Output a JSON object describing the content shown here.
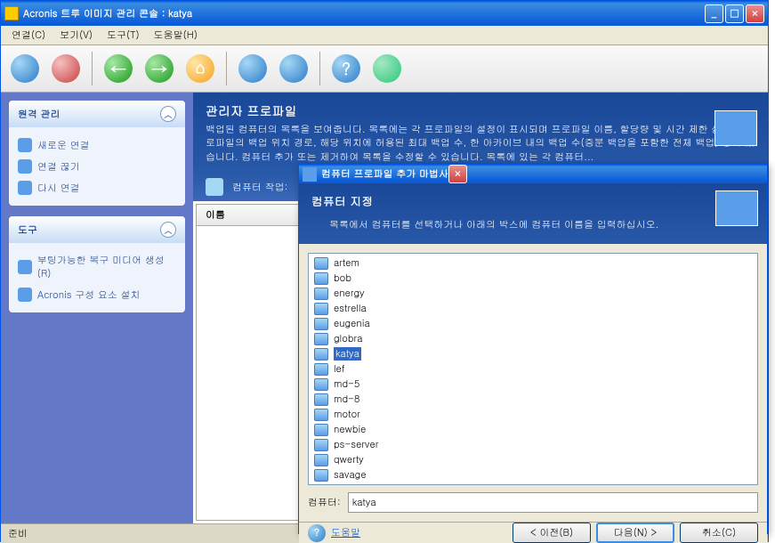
{
  "main": {
    "title": "Acronis 트루 이미지 관리 콘솔 : katya",
    "menu": {
      "connect": "연결(C)",
      "view": "보기(V)",
      "tools": "도구(T)",
      "help": "도움말(H)"
    },
    "sidebar": {
      "panel1": {
        "title": "원격 관리",
        "links": [
          "새로운 연결",
          "연결 끊기",
          "다시 연결"
        ]
      },
      "panel2": {
        "title": "도구",
        "links": [
          "부팅가능한 복구 미디어 생성(R)",
          "Acronis 구성 요소 설치"
        ]
      }
    },
    "banner": {
      "title": "관리자 프로파일",
      "desc": "백업된 컴퓨터의 목록을 보여줍니다. 목록에는 각 프로파일의 설정이 표시되며 프로파일 이름, 할당량 및 시간 제한 설정, 프로파일의 백업 위치 경로, 해당 위치에 허용된 최대 백업 수, 한 아카이브 내의 백업 수(증분 백업을 포함한 전체 백업) 등이 있습니다. 컴퓨터 추가 또는 제거하여 목록을 수정할 수 있습니다. 목록에 있는 각 컴퓨터..."
    },
    "subbar": {
      "label": "컴퓨터 작업:"
    },
    "listheader": "이름",
    "status": "준비"
  },
  "wizard": {
    "title": "컴퓨터 프로파일 추가 마법사",
    "header": "컴퓨터 지정",
    "instruction": "목록에서 컴퓨터를 선택하거나 아래의 박스에 컴퓨터 이름을 입력하십시오.",
    "computers": [
      "artem",
      "bob",
      "energy",
      "estrella",
      "eugenia",
      "globra",
      "katya",
      "lef",
      "md-5",
      "md-8",
      "motor",
      "newbie",
      "ps-server",
      "qwerty",
      "savage"
    ],
    "selected": "katya",
    "input_label": "컴퓨터:",
    "input_value": "katya",
    "help": "도움말",
    "buttons": {
      "back": "< 이전(B)",
      "next": "다음(N) >",
      "cancel": "취소(C)"
    }
  }
}
